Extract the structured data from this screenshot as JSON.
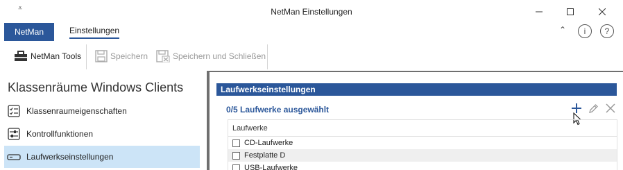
{
  "window": {
    "title": "NetMan Einstellungen",
    "quick_access_glyph": "⩡"
  },
  "tabs": {
    "netman": "NetMan",
    "einstellungen": "Einstellungen"
  },
  "ribbon": {
    "netman_tools": "NetMan Tools",
    "speichern": "Speichern",
    "speichern_schliessen": "Speichern und Schließen"
  },
  "left": {
    "heading": "Klassenräume Windows Clients",
    "items": [
      {
        "label": "Klassenraumeigenschaften",
        "icon": "checklist-icon"
      },
      {
        "label": "Kontrollfunktionen",
        "icon": "sliders-icon"
      },
      {
        "label": "Laufwerkseinstellungen",
        "icon": "drive-icon"
      }
    ]
  },
  "right": {
    "section_title": "Laufwerkseinstellungen",
    "selection_text": "0/5 Laufwerke ausgewählt",
    "table": {
      "header": "Laufwerke",
      "rows": [
        "CD-Laufwerke",
        "Festplatte D",
        "USB-Laufwerke"
      ]
    }
  },
  "colors": {
    "accent": "#2b579a",
    "selected": "#cce4f7"
  }
}
